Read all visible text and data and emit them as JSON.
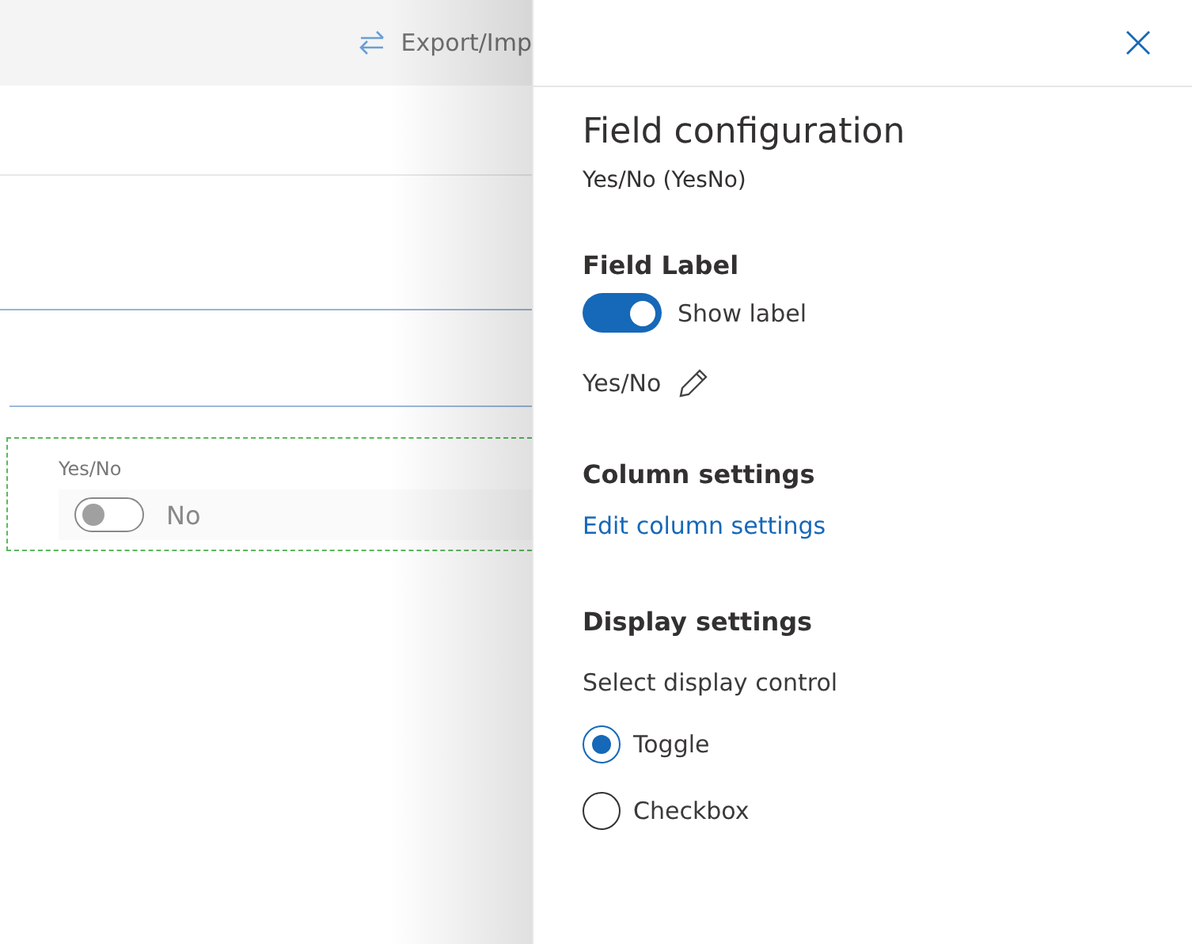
{
  "toolbar": {
    "export_label": "Export/Imp"
  },
  "form_preview": {
    "field_label": "Yes/No",
    "toggle_on": false,
    "toggle_text": "No"
  },
  "panel": {
    "title": "Field configuration",
    "subtitle": "Yes/No (YesNo)",
    "field_label_section": {
      "heading": "Field Label",
      "show_label_on": true,
      "show_label_text": "Show label",
      "label_value": "Yes/No"
    },
    "column_section": {
      "heading": "Column settings",
      "link": "Edit column settings"
    },
    "display_section": {
      "heading": "Display settings",
      "prompt": "Select display control",
      "options": [
        {
          "label": "Toggle",
          "selected": true
        },
        {
          "label": "Checkbox",
          "selected": false
        }
      ]
    }
  }
}
